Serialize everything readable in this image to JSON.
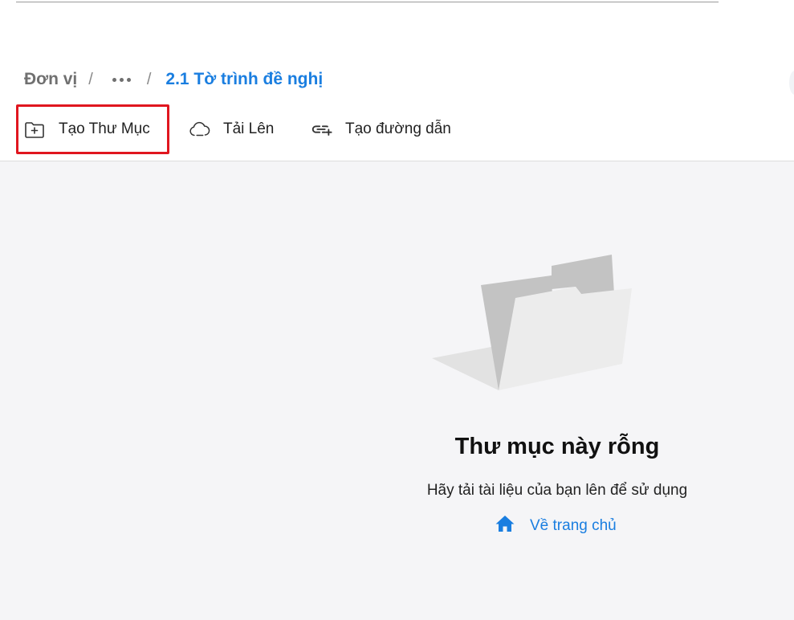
{
  "breadcrumb": {
    "root": "Đơn vị",
    "separator": "/",
    "current": "2.1 Tờ trình đề nghị"
  },
  "toolbar": {
    "create_folder": {
      "label": "Tạo Thư Mục",
      "icon": "folder-plus-icon"
    },
    "upload": {
      "label": "Tải Lên",
      "icon": "cloud-icon"
    },
    "create_link": {
      "label": "Tạo đường dẫn",
      "icon": "link-plus-icon"
    }
  },
  "empty_state": {
    "title": "Thư mục này rỗng",
    "subtitle": "Hãy tải tài liệu của bạn lên để sử dụng",
    "home_link": "Về trang chủ",
    "home_icon": "home-icon"
  },
  "colors": {
    "accent": "#1a7ee0",
    "highlight_border": "#e0161f",
    "content_bg": "#f5f5f7"
  }
}
